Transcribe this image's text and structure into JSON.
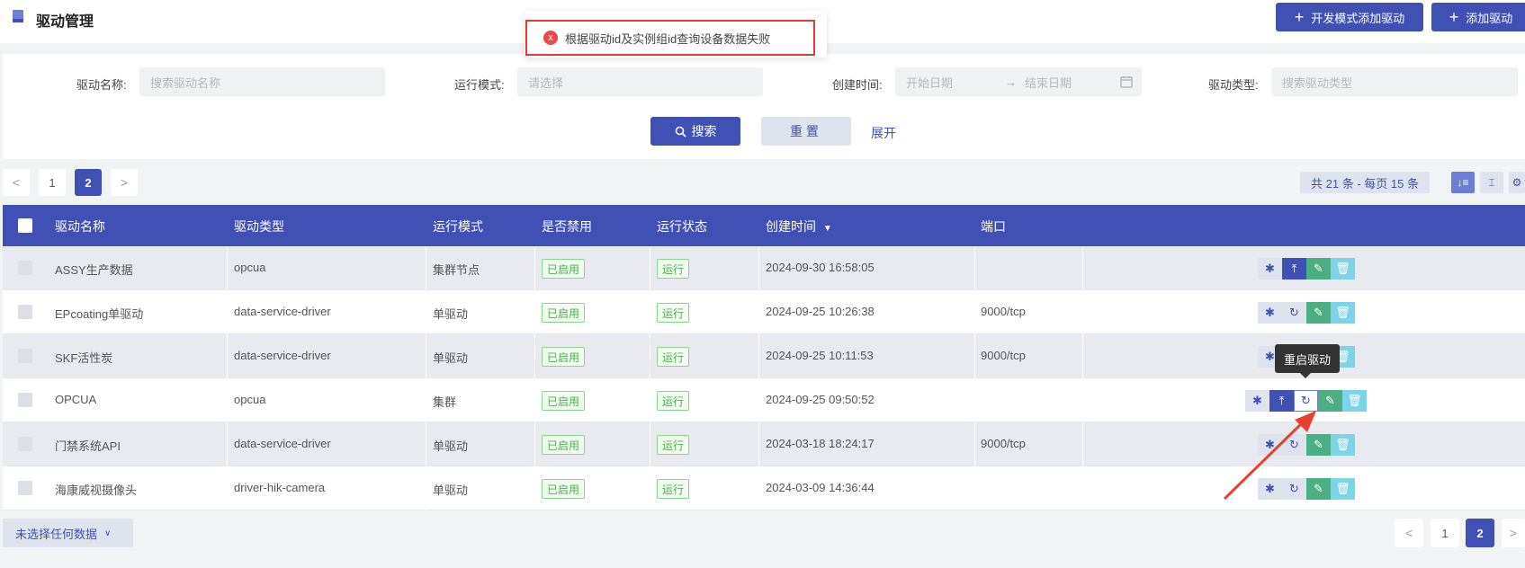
{
  "header": {
    "title": "驱动管理",
    "dev_add_label": "开发模式添加驱动",
    "add_label": "添加驱动"
  },
  "toast": {
    "message": "根据驱动id及实例组id查询设备数据失败",
    "icon": "x"
  },
  "filters": {
    "name_label": "驱动名称:",
    "name_placeholder": "搜索驱动名称",
    "mode_label": "运行模式:",
    "mode_placeholder": "请选择",
    "time_label": "创建时间:",
    "start_placeholder": "开始日期",
    "range_arrow": "→",
    "end_placeholder": "结束日期",
    "type_label": "驱动类型:",
    "type_placeholder": "搜索驱动类型",
    "search_label": "搜索",
    "reset_label": "重置",
    "expand_label": "展开"
  },
  "pagination_top": {
    "prev": "<",
    "pages": [
      "1",
      "2"
    ],
    "next": ">",
    "current": "2"
  },
  "summary": "共 21 条 - 每页 15 条",
  "table": {
    "headers": [
      "驱动名称",
      "驱动类型",
      "运行模式",
      "是否禁用",
      "运行状态",
      "创建时间",
      "端口"
    ],
    "sort_indicator": "▼",
    "rows": [
      {
        "name": "ASSY生产数据",
        "type": "opcua",
        "mode": "集群节点",
        "disabled": "已启用",
        "status": "运行",
        "created": "2024-09-30 16:58:05",
        "port": ""
      },
      {
        "name": "EPcoating单驱动",
        "type": "data-service-driver",
        "mode": "单驱动",
        "disabled": "已启用",
        "status": "运行",
        "created": "2024-09-25 10:26:38",
        "port": "9000/tcp"
      },
      {
        "name": "SKF活性炭",
        "type": "data-service-driver",
        "mode": "单驱动",
        "disabled": "已启用",
        "status": "运行",
        "created": "2024-09-25 10:11:53",
        "port": "9000/tcp"
      },
      {
        "name": "OPCUA",
        "type": "opcua",
        "mode": "集群",
        "disabled": "已启用",
        "status": "运行",
        "created": "2024-09-25 09:50:52",
        "port": ""
      },
      {
        "name": "门禁系统API",
        "type": "data-service-driver",
        "mode": "单驱动",
        "disabled": "已启用",
        "status": "运行",
        "created": "2024-03-18 18:24:17",
        "port": "9000/tcp"
      },
      {
        "name": "海康威视摄像头",
        "type": "driver-hik-camera",
        "mode": "单驱动",
        "disabled": "已启用",
        "status": "运行",
        "created": "2024-03-09 14:36:44",
        "port": ""
      }
    ]
  },
  "tooltip": "重启驱动",
  "selection_label": "未选择任何数据",
  "pagination_bottom": {
    "prev": "<",
    "pages": [
      "1",
      "2"
    ],
    "next": ">",
    "current": "2"
  },
  "colors": {
    "primary": "#3f51b5",
    "success": "#4caf50",
    "danger": "#e53935",
    "annotation": "#e8412c"
  },
  "icons": [
    "drive-icon",
    "plus-icon",
    "error-icon",
    "search-icon",
    "calendar-icon",
    "sort-icon",
    "column-height-icon",
    "settings-icon",
    "bug-icon",
    "upload-icon",
    "restart-icon",
    "edit-icon",
    "delete-icon",
    "chevron-down-icon"
  ]
}
